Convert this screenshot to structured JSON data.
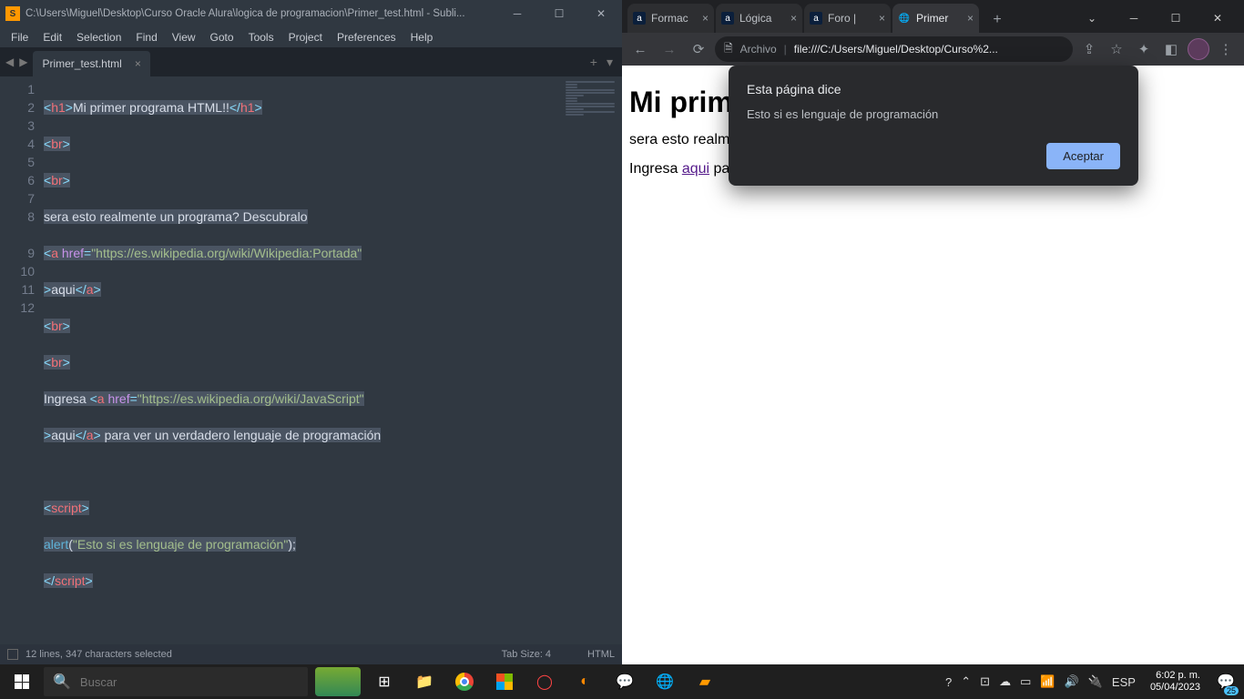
{
  "sublime": {
    "title": "C:\\Users\\Miguel\\Desktop\\Curso Oracle Alura\\logica de programacion\\Primer_test.html - Subli...",
    "menu": [
      "File",
      "Edit",
      "Selection",
      "Find",
      "View",
      "Goto",
      "Tools",
      "Project",
      "Preferences",
      "Help"
    ],
    "tab": {
      "name": "Primer_test.html"
    },
    "lines": [
      "1",
      "2",
      "3",
      "4",
      "5",
      "6",
      "7",
      "8",
      "",
      "9",
      "10",
      "11",
      "12"
    ],
    "code_tokens": {
      "l1_h1o": "h1",
      "l1_txt": "Mi primer programa HTML!!",
      "l1_h1c": "h1",
      "br": "br",
      "l4": "sera esto realmente un programa? Descubralo",
      "a": "a",
      "href": "href",
      "eq": "=",
      "url1": "\"https://es.wikipedia.org/wiki/Wikipedia:Portada\"",
      "l5b": "aqui",
      "l8a": "Ingresa ",
      "url2": "\"https://es.wikipedia.org/wiki/JavaScript\"",
      "l8b": "aqui",
      "l8c": " para ver un verdadero lenguaje de programación",
      "script": "script",
      "alert": "alert",
      "alertstr": "\"Esto si es lenguaje de programación\"",
      "paren_open": "(",
      "paren_close": ");"
    },
    "status": {
      "left": "12 lines, 347 characters selected",
      "tab": "Tab Size: 4",
      "lang": "HTML"
    }
  },
  "chrome": {
    "tabs": [
      {
        "label": "Formac",
        "fav": "a"
      },
      {
        "label": "Lógica",
        "fav": "a"
      },
      {
        "label": "Foro |",
        "fav": "a"
      },
      {
        "label": "Primer",
        "fav": "🌐",
        "active": true
      }
    ],
    "toolbar": {
      "archivo": "Archivo",
      "url": "file:///C:/Users/Miguel/Desktop/Curso%2..."
    },
    "page": {
      "h1": "Mi primer programa HTML!!",
      "p1": "sera esto realmente un programa? Descubralo ",
      "p2a": "Ingresa ",
      "p2link": "aqui",
      "p2b": " para ver un verdadero lenguaje de programación"
    },
    "dialog": {
      "title": "Esta página dice",
      "msg": "Esto si es lenguaje de programación",
      "btn": "Aceptar"
    }
  },
  "taskbar": {
    "search_placeholder": "Buscar",
    "lang": "ESP",
    "time": "6:02 p. m.",
    "date": "05/04/2023",
    "notif": "25"
  }
}
